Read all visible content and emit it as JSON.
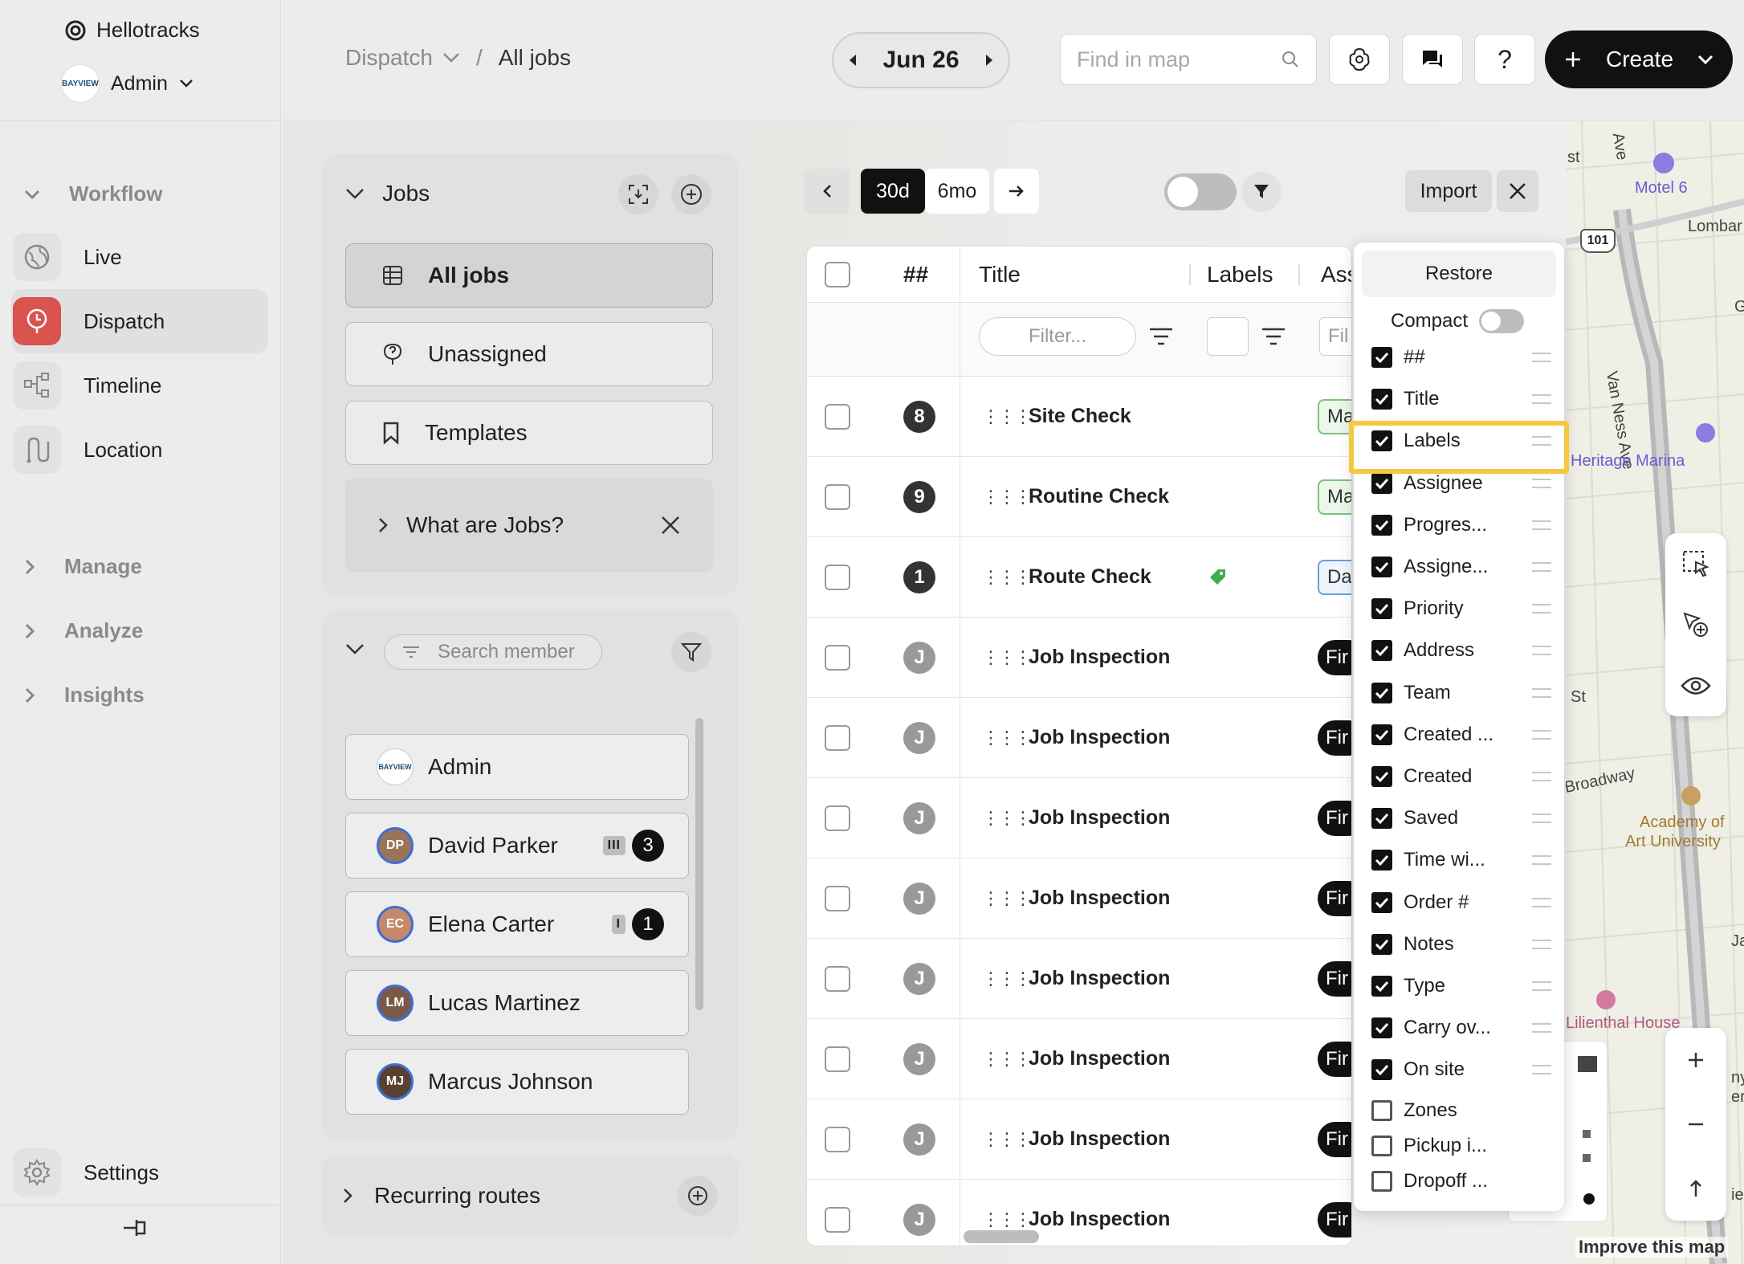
{
  "sidebar": {
    "org_name": "Hellotracks",
    "user_name": "Admin",
    "user_avatar_text": "BAYVIEW",
    "workflow_label": "Workflow",
    "items": [
      {
        "label": "Live",
        "icon": "globe-icon"
      },
      {
        "label": "Dispatch",
        "icon": "dispatch-icon",
        "active": true
      },
      {
        "label": "Timeline",
        "icon": "timeline-icon"
      },
      {
        "label": "Location",
        "icon": "location-route-icon"
      }
    ],
    "sections": [
      "Manage",
      "Analyze",
      "Insights"
    ],
    "settings_label": "Settings"
  },
  "topbar": {
    "breadcrumb_parent": "Dispatch",
    "breadcrumb_current": "All jobs",
    "date": "Jun 26",
    "find_placeholder": "Find in map",
    "help_label": "?",
    "create_label": "Create"
  },
  "jobs_panel": {
    "title": "Jobs",
    "views": [
      {
        "label": "All jobs",
        "icon": "table-icon",
        "selected": true
      },
      {
        "label": "Unassigned",
        "icon": "pin-question-icon"
      },
      {
        "label": "Templates",
        "icon": "bookmark-icon"
      }
    ],
    "help_label": "What are Jobs?",
    "search_placeholder": "Search member",
    "members": [
      {
        "name": "Admin",
        "avatar": "BAYVIEW",
        "bars": "",
        "count": ""
      },
      {
        "name": "David Parker",
        "avatar": "DP",
        "bars": "III",
        "count": "3"
      },
      {
        "name": "Elena Carter",
        "avatar": "EC",
        "bars": "I",
        "count": "1"
      },
      {
        "name": "Lucas Martinez",
        "avatar": "LM",
        "bars": "",
        "count": ""
      },
      {
        "name": "Marcus Johnson",
        "avatar": "MJ",
        "bars": "",
        "count": ""
      }
    ],
    "recurring_label": "Recurring routes"
  },
  "toolbar": {
    "range_30d": "30d",
    "range_6mo": "6mo",
    "import_label": "Import"
  },
  "table": {
    "headers": {
      "num": "##",
      "title": "Title",
      "labels": "Labels",
      "assignee": "Ass"
    },
    "filter_placeholder": "Filter...",
    "filter_placeholder_short": "Fil",
    "rows": [
      {
        "id": "8",
        "title": "Site Check",
        "label": "Ma",
        "label_style": "green",
        "dark": true
      },
      {
        "id": "9",
        "title": "Routine Check",
        "label": "Ma",
        "label_style": "green",
        "dark": true
      },
      {
        "id": "1",
        "title": "Route Check",
        "label": "Da",
        "label_style": "blue",
        "dark": true,
        "tag": true
      },
      {
        "id": "J",
        "title": "Job Inspection",
        "label": "Fir",
        "label_style": "black"
      },
      {
        "id": "J",
        "title": "Job Inspection",
        "label": "Fir",
        "label_style": "black"
      },
      {
        "id": "J",
        "title": "Job Inspection",
        "label": "Fir",
        "label_style": "black"
      },
      {
        "id": "J",
        "title": "Job Inspection",
        "label": "Fir",
        "label_style": "black"
      },
      {
        "id": "J",
        "title": "Job Inspection",
        "label": "Fir",
        "label_style": "black"
      },
      {
        "id": "J",
        "title": "Job Inspection",
        "label": "Fir",
        "label_style": "black"
      },
      {
        "id": "J",
        "title": "Job Inspection",
        "label": "Fir",
        "label_style": "black"
      },
      {
        "id": "J",
        "title": "Job Inspection",
        "label": "Fir",
        "label_style": "black"
      }
    ]
  },
  "columns_menu": {
    "restore_label": "Restore",
    "compact_label": "Compact",
    "options": [
      {
        "label": "##",
        "checked": true
      },
      {
        "label": "Title",
        "checked": true
      },
      {
        "label": "Labels",
        "checked": true,
        "highlighted": true
      },
      {
        "label": "Assignee",
        "checked": true
      },
      {
        "label": "Progres...",
        "checked": true
      },
      {
        "label": "Assigne...",
        "checked": true
      },
      {
        "label": "Priority",
        "checked": true
      },
      {
        "label": "Address",
        "checked": true
      },
      {
        "label": "Team",
        "checked": true
      },
      {
        "label": "Created ...",
        "checked": true
      },
      {
        "label": "Created",
        "checked": true
      },
      {
        "label": "Saved",
        "checked": true
      },
      {
        "label": "Time wi...",
        "checked": true
      },
      {
        "label": "Order #",
        "checked": true
      },
      {
        "label": "Notes",
        "checked": true
      },
      {
        "label": "Type",
        "checked": true
      },
      {
        "label": "Carry ov...",
        "checked": true
      },
      {
        "label": "On site",
        "checked": true
      },
      {
        "label": "Zones",
        "checked": false
      },
      {
        "label": "Pickup i...",
        "checked": false
      },
      {
        "label": "Dropoff ...",
        "checked": false
      }
    ]
  },
  "map": {
    "labels": {
      "motel": "Motel 6",
      "lombard": "Lombar",
      "vanness": "Van Ness Ave",
      "heritage": "Heritage Marina",
      "broadway": "Broadway",
      "academy1": "Academy of",
      "academy2": "Art University",
      "lilienthal": "Lilienthal House",
      "ave": "Ave",
      "st1": "st",
      "st2": "St",
      "g": "G",
      "ja": "Ja",
      "ny": "ny",
      "er": "er",
      "ie": "ie",
      "route": "101",
      "improve": "Improve this map"
    }
  },
  "colors": {
    "accent": "#d9534f",
    "highlight": "#f5c842",
    "label_green": "#7cc27c",
    "label_blue": "#6aa0d8"
  }
}
